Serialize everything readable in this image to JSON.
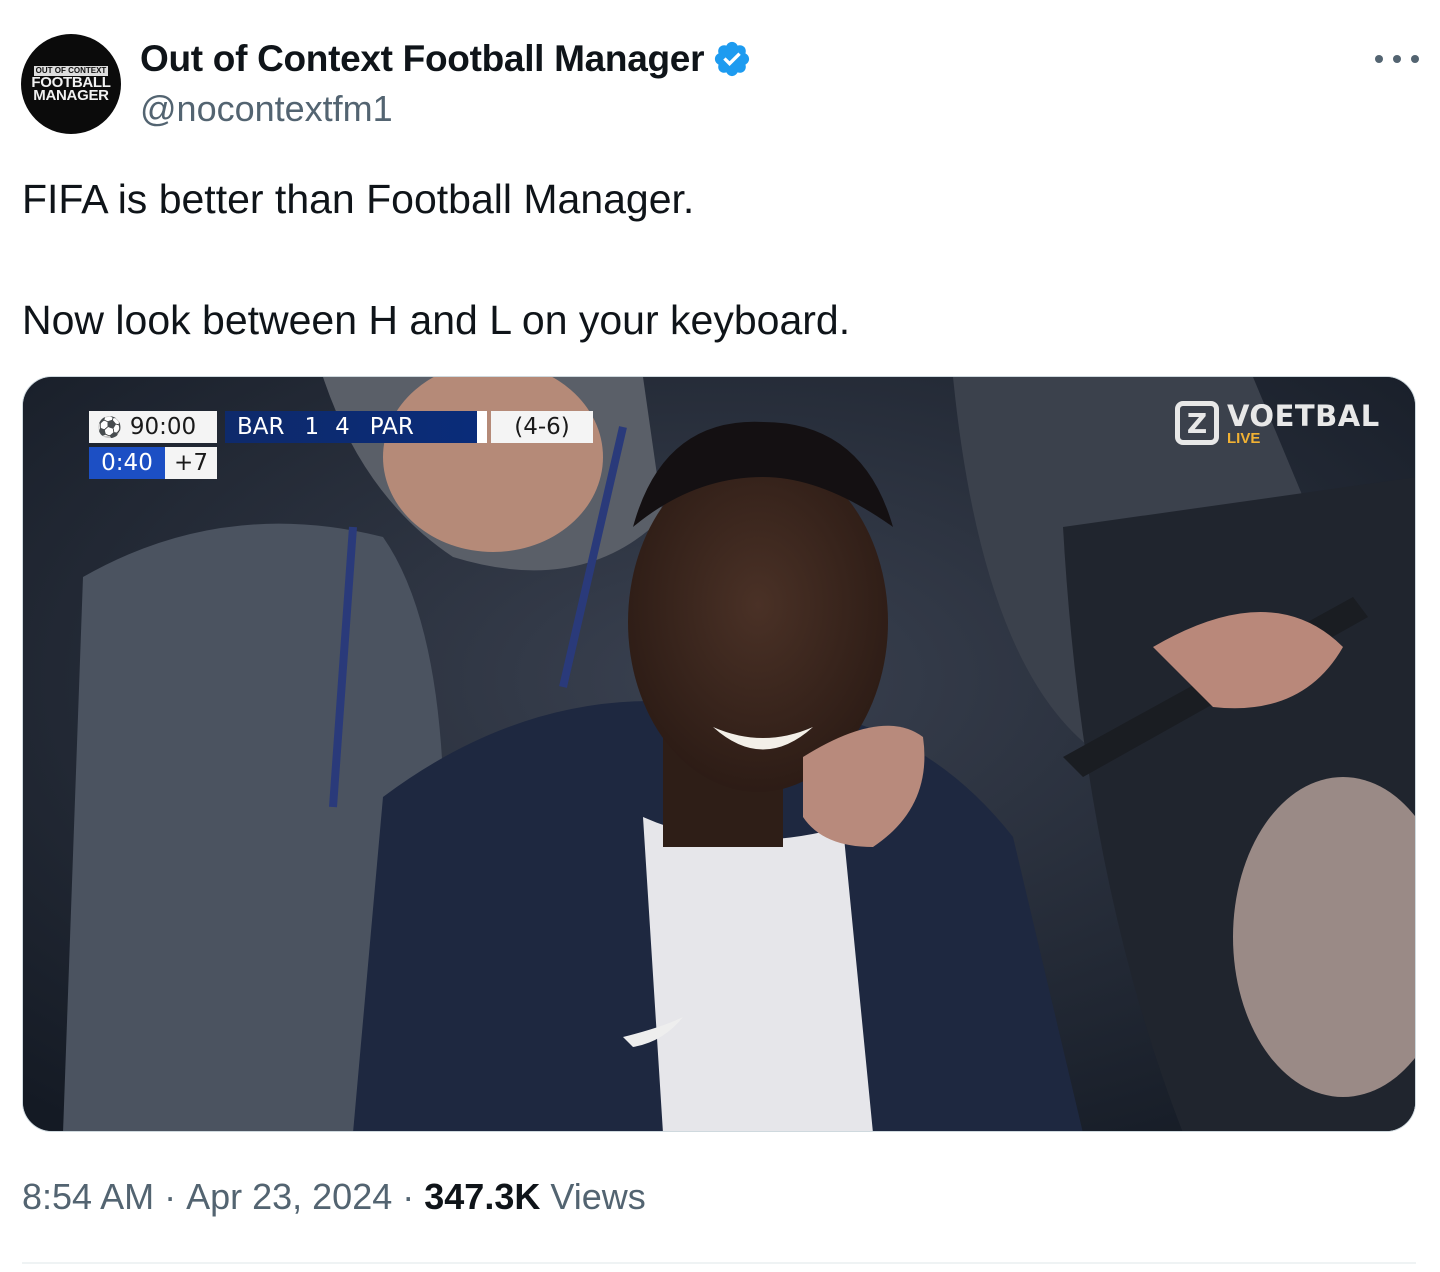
{
  "author": {
    "display_name": "Out of Context Football Manager",
    "handle": "@nocontextfm1",
    "verified": true,
    "avatar_text": {
      "line1": "OUT OF CONTEXT",
      "line2": "FOOTBALL",
      "line3": "MANAGER"
    }
  },
  "tweet": {
    "paragraph1": "FIFA is better than Football Manager.",
    "paragraph2": "Now look between H and L on your keyboard."
  },
  "media": {
    "scorebug": {
      "match_time": "90:00",
      "home": "BAR",
      "home_score": "1",
      "away_score": "4",
      "away": "PAR",
      "aggregate": "(4-6)",
      "added_time_elapsed": "0:40",
      "added_time": "+7"
    },
    "broadcaster": {
      "logo": "Z",
      "name": "VOETBAL",
      "sub": "LIVE"
    }
  },
  "meta": {
    "time": "8:54 AM",
    "date": "Apr 23, 2024",
    "views_count": "347.3K",
    "views_label": "Views"
  },
  "colors": {
    "verified_badge": "#1d9bf0",
    "secondary_text": "#536471",
    "scorebug_blue": "#0e2a6b",
    "broadcaster_live": "#f2b233"
  },
  "icons": [
    "verified-badge-icon",
    "more-options-icon",
    "champions-league-ball-icon"
  ]
}
